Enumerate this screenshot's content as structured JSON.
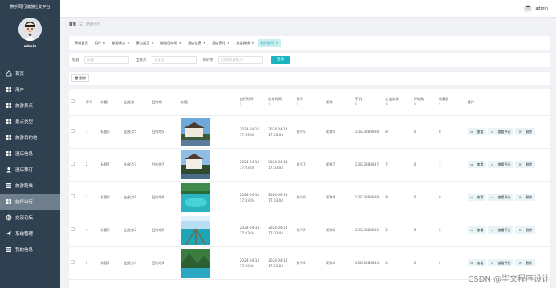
{
  "brand": "携手同行旅游社交平台",
  "user": {
    "name": "admin"
  },
  "menu": [
    {
      "label": "首页",
      "icon": "home-icon"
    },
    {
      "label": "用户",
      "icon": "grid-icon"
    },
    {
      "label": "旅游景点",
      "icon": "grid-icon"
    },
    {
      "label": "景点类型",
      "icon": "grid-icon"
    },
    {
      "label": "旅游目的地",
      "icon": "grid-icon"
    },
    {
      "label": "酒店信息",
      "icon": "grid-icon"
    },
    {
      "label": "酒店预订",
      "icon": "person-icon"
    },
    {
      "label": "旅游路线",
      "icon": "list-icon"
    },
    {
      "label": "结伴出行",
      "icon": "grid-icon"
    },
    {
      "label": "交流论坛",
      "icon": "globe-icon"
    },
    {
      "label": "系统管理",
      "icon": "send-icon"
    },
    {
      "label": "我的信息",
      "icon": "list-icon"
    }
  ],
  "topbar": {
    "username": "admin"
  },
  "breadcrumb": {
    "home": "首页",
    "current": "结伴出行"
  },
  "tabs": [
    {
      "label": "系统首页",
      "closable": false
    },
    {
      "label": "用户",
      "closable": true
    },
    {
      "label": "旅游景点",
      "closable": true
    },
    {
      "label": "景点类型",
      "closable": true
    },
    {
      "label": "旅游目的地",
      "closable": true
    },
    {
      "label": "酒店信息",
      "closable": true
    },
    {
      "label": "酒店预订",
      "closable": true
    },
    {
      "label": "旅游路线",
      "closable": true
    },
    {
      "label": "结伴出行",
      "closable": true
    }
  ],
  "search": {
    "title_label": "标题",
    "title_placeholder": "标题",
    "from_label": "出发点",
    "from_placeholder": "出发点",
    "dest_label": "目的地",
    "dest_placeholder": "目的地(请输入)",
    "button": "查询"
  },
  "actions": {
    "delete": "删除"
  },
  "table": {
    "columns": [
      "序号",
      "标题",
      "出发点",
      "目的地",
      "封面",
      "出行时间",
      "约束时间",
      "账号",
      "昵称",
      "手机",
      "点击次数",
      "评论数",
      "收藏数",
      "操作"
    ],
    "rows": [
      {
        "index": "1",
        "title": "标题5",
        "from": "出发点5",
        "dest": "目的地5",
        "start": "2024-04-14 17:03:04",
        "end": "2024-04-14 17:03:04",
        "account": "账号5",
        "nick": "昵称5",
        "phone": "13823888888",
        "clicks": "8",
        "comments": "0",
        "favs": "8",
        "img": "a"
      },
      {
        "index": "2",
        "title": "标题7",
        "from": "出发点7",
        "dest": "目的地7",
        "start": "2024-04-14 17:03:04",
        "end": "2024-04-14 17:03:04",
        "account": "账号7",
        "nick": "昵称7",
        "phone": "13823888887",
        "clicks": "7",
        "comments": "0",
        "favs": "7",
        "img": "b"
      },
      {
        "index": "3",
        "title": "标题8",
        "from": "出发点8",
        "dest": "目的地8",
        "start": "2024-04-14 17:03:04",
        "end": "2024-04-14 17:03:04",
        "account": "账号8",
        "nick": "昵称8",
        "phone": "13823888888",
        "clicks": "8",
        "comments": "0",
        "favs": "8",
        "img": "c"
      },
      {
        "index": "4",
        "title": "标题2",
        "from": "出发点2",
        "dest": "目的地2",
        "start": "2024-04-14 17:03:04",
        "end": "2024-04-14 17:03:04",
        "account": "账号2",
        "nick": "昵称2",
        "phone": "13823888882",
        "clicks": "2",
        "comments": "0",
        "favs": "2",
        "img": "d"
      },
      {
        "index": "5",
        "title": "标题4",
        "from": "出发点4",
        "dest": "目的地4",
        "start": "2024-04-14 17:03:04",
        "end": "2024-04-14 17:03:04",
        "account": "账号4",
        "nick": "昵称4",
        "phone": "13823888884",
        "clicks": "4",
        "comments": "0",
        "favs": "4",
        "img": "e"
      }
    ],
    "ops": [
      "查看",
      "查看评论",
      "删除"
    ]
  },
  "watermark": "CSDN @毕文程序设计"
}
